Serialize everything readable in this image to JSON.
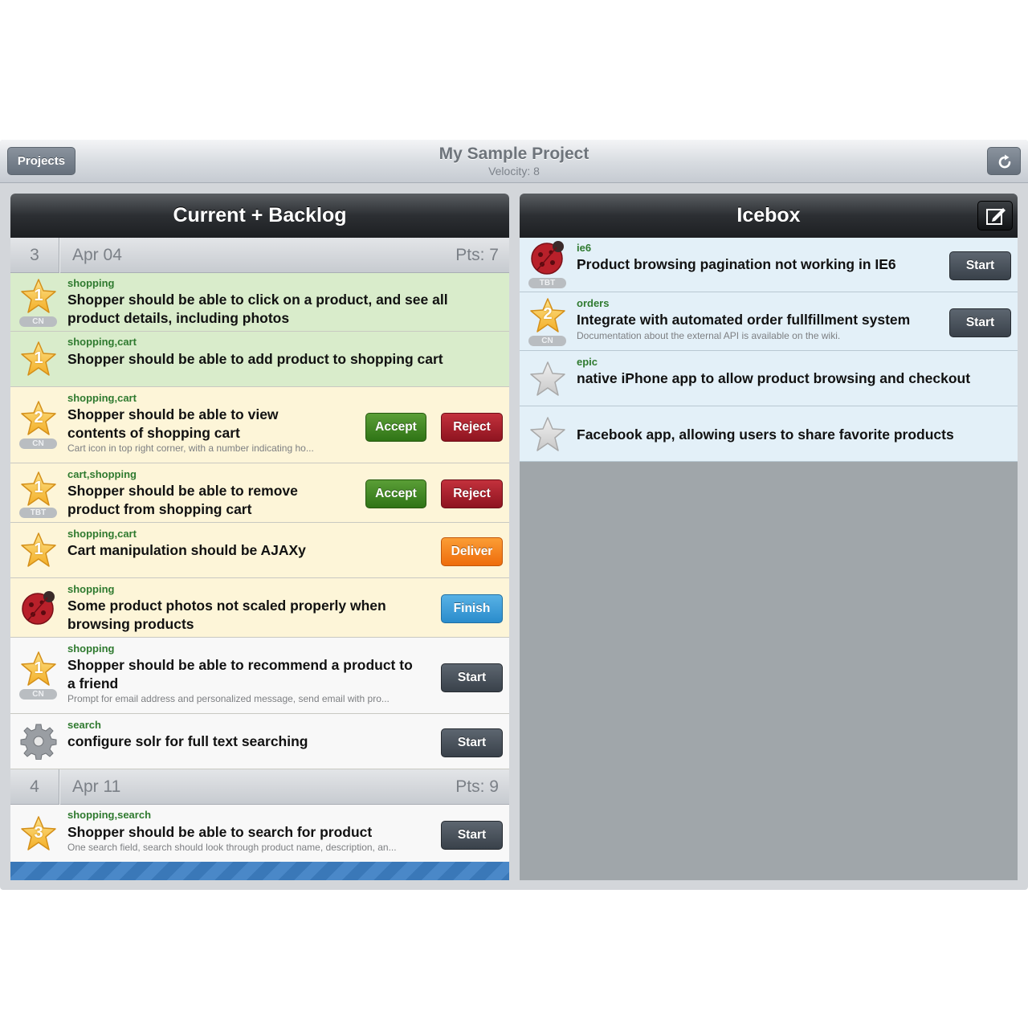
{
  "header": {
    "projects_label": "Projects",
    "title": "My Sample Project",
    "velocity": "Velocity: 8"
  },
  "left_panel": {
    "title": "Current + Backlog",
    "iterations": [
      {
        "number": "3",
        "date": "Apr 04",
        "points": "Pts: 7"
      },
      {
        "number": "4",
        "date": "Apr 11",
        "points": "Pts: 9"
      }
    ],
    "stories": [
      {
        "labels": "shopping",
        "name": "Shopper should be able to click on a product, and see all product details, including photos",
        "estimate": "1",
        "owner": "CN",
        "icon": "star-icon"
      },
      {
        "labels": "shopping,cart",
        "name": "Shopper should be able to add product to shopping cart",
        "estimate": "1",
        "owner": "",
        "icon": "star-icon"
      },
      {
        "labels": "shopping,cart",
        "name": "Shopper should be able to view contents of shopping cart",
        "description": "Cart icon in top right corner, with a number indicating ho...",
        "estimate": "2",
        "owner": "CN",
        "icon": "star-icon",
        "buttons": [
          "Accept",
          "Reject"
        ]
      },
      {
        "labels": "cart,shopping",
        "name": "Shopper should be able to remove product from shopping cart",
        "estimate": "1",
        "owner": "TBT",
        "icon": "star-icon",
        "buttons": [
          "Accept",
          "Reject"
        ]
      },
      {
        "labels": "shopping,cart",
        "name": "Cart manipulation should be AJAXy",
        "estimate": "1",
        "owner": "",
        "icon": "star-icon",
        "buttons": [
          "Deliver"
        ]
      },
      {
        "labels": "shopping",
        "name": "Some product photos not scaled properly when browsing products",
        "icon": "bug-icon",
        "buttons": [
          "Finish"
        ]
      },
      {
        "labels": "shopping",
        "name": "Shopper should be able to recommend a product to a friend",
        "description": "Prompt for email address and personalized message, send email with pro...",
        "estimate": "1",
        "owner": "CN",
        "icon": "star-icon",
        "buttons": [
          "Start"
        ]
      },
      {
        "labels": "search",
        "name": "configure solr for full text searching",
        "icon": "gear-icon",
        "buttons": [
          "Start"
        ]
      },
      {
        "labels": "shopping,search",
        "name": "Shopper should be able to search for product",
        "description": "One search field, search should look through product name, description, an...",
        "estimate": "3",
        "owner": "",
        "icon": "star-icon",
        "buttons": [
          "Start"
        ]
      }
    ]
  },
  "right_panel": {
    "title": "Icebox",
    "stories": [
      {
        "labels": "ie6",
        "name": "Product browsing pagination not working in IE6",
        "owner": "TBT",
        "icon": "bug-icon",
        "buttons": [
          "Start"
        ]
      },
      {
        "labels": "orders",
        "name": "Integrate with automated order fullfillment system",
        "description": "Documentation about the external API is available on the wiki.",
        "estimate": "2",
        "owner": "CN",
        "icon": "star-icon",
        "buttons": [
          "Start"
        ]
      },
      {
        "labels": "epic",
        "name": "native iPhone app to allow product browsing and checkout",
        "icon": "star-empty-icon"
      },
      {
        "labels": "",
        "name": "Facebook app, allowing users to share favorite products",
        "icon": "star-empty-icon"
      }
    ]
  },
  "colors": {
    "accepted": "#d9eccb",
    "in_progress": "#fdf5d8",
    "unstarted": "#f8f8f8",
    "icebox": "#e3f0f8",
    "label_green": "#2f7a2f"
  }
}
